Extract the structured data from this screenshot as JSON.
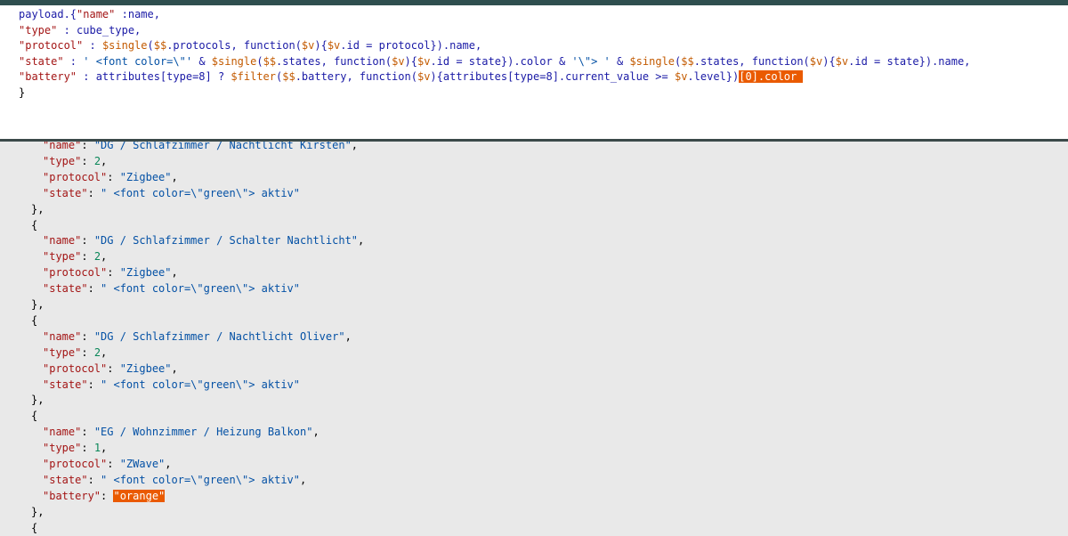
{
  "editor": {
    "lines": [
      {
        "segments": [
          {
            "t": "payload.{",
            "c": "plain"
          },
          {
            "t": "\"name\"",
            "c": "key"
          },
          {
            "t": " :name,",
            "c": "plain"
          }
        ]
      },
      {
        "segments": [
          {
            "t": "\"type\"",
            "c": "key"
          },
          {
            "t": " : cube_type,",
            "c": "plain"
          }
        ]
      },
      {
        "segments": [
          {
            "t": "\"protocol\"",
            "c": "key"
          },
          {
            "t": " : ",
            "c": "plain"
          },
          {
            "t": "$single",
            "c": "var"
          },
          {
            "t": "(",
            "c": "plain"
          },
          {
            "t": "$$",
            "c": "var"
          },
          {
            "t": ".protocols, function(",
            "c": "plain"
          },
          {
            "t": "$v",
            "c": "var"
          },
          {
            "t": "){",
            "c": "plain"
          },
          {
            "t": "$v",
            "c": "var"
          },
          {
            "t": ".id = protocol}).name,",
            "c": "plain"
          }
        ]
      },
      {
        "segments": [
          {
            "t": "\"state\"",
            "c": "key"
          },
          {
            "t": " : ",
            "c": "plain"
          },
          {
            "t": "' <font color=\\\"'",
            "c": "str"
          },
          {
            "t": " & ",
            "c": "plain"
          },
          {
            "t": "$single",
            "c": "var"
          },
          {
            "t": "(",
            "c": "plain"
          },
          {
            "t": "$$",
            "c": "var"
          },
          {
            "t": ".states, function(",
            "c": "plain"
          },
          {
            "t": "$v",
            "c": "var"
          },
          {
            "t": "){",
            "c": "plain"
          },
          {
            "t": "$v",
            "c": "var"
          },
          {
            "t": ".id = state}).color & ",
            "c": "plain"
          },
          {
            "t": "'\\\"> '",
            "c": "str"
          },
          {
            "t": " & ",
            "c": "plain"
          },
          {
            "t": "$single",
            "c": "var"
          },
          {
            "t": "(",
            "c": "plain"
          },
          {
            "t": "$$",
            "c": "var"
          },
          {
            "t": ".states, function(",
            "c": "plain"
          },
          {
            "t": "$v",
            "c": "var"
          },
          {
            "t": "){",
            "c": "plain"
          },
          {
            "t": "$v",
            "c": "var"
          },
          {
            "t": ".id = state}).name,",
            "c": "plain"
          }
        ]
      },
      {
        "segments": [
          {
            "t": "\"battery\"",
            "c": "key"
          },
          {
            "t": " : attributes[type=8] ? ",
            "c": "plain"
          },
          {
            "t": "$filter",
            "c": "var"
          },
          {
            "t": "(",
            "c": "plain"
          },
          {
            "t": "$$",
            "c": "var"
          },
          {
            "t": ".battery, function(",
            "c": "plain"
          },
          {
            "t": "$v",
            "c": "var"
          },
          {
            "t": "){attributes[type=8].current_value >= ",
            "c": "plain"
          },
          {
            "t": "$v",
            "c": "var"
          },
          {
            "t": ".level})",
            "c": "plain"
          },
          {
            "t": "[0].color ",
            "c": "hl"
          }
        ]
      },
      {
        "segments": [
          {
            "t": "}",
            "c": "op"
          }
        ]
      }
    ]
  },
  "output": {
    "lines": [
      {
        "indent": 1,
        "segments": [
          {
            "t": "\"name\"",
            "c": "key"
          },
          {
            "t": ": ",
            "c": "op"
          },
          {
            "t": "\"DG / Schlafzimmer / Nachtlicht Kirsten\"",
            "c": "str"
          },
          {
            "t": ",",
            "c": "op"
          }
        ]
      },
      {
        "indent": 1,
        "segments": [
          {
            "t": "\"type\"",
            "c": "key"
          },
          {
            "t": ": ",
            "c": "op"
          },
          {
            "t": "2",
            "c": "num"
          },
          {
            "t": ",",
            "c": "op"
          }
        ]
      },
      {
        "indent": 1,
        "segments": [
          {
            "t": "\"protocol\"",
            "c": "key"
          },
          {
            "t": ": ",
            "c": "op"
          },
          {
            "t": "\"Zigbee\"",
            "c": "str"
          },
          {
            "t": ",",
            "c": "op"
          }
        ]
      },
      {
        "indent": 1,
        "segments": [
          {
            "t": "\"state\"",
            "c": "key"
          },
          {
            "t": ": ",
            "c": "op"
          },
          {
            "t": "\" <font color=\\\"green\\\"> aktiv\"",
            "c": "str"
          }
        ]
      },
      {
        "indent": 0,
        "segments": [
          {
            "t": "},",
            "c": "op"
          }
        ]
      },
      {
        "indent": 0,
        "segments": [
          {
            "t": "{",
            "c": "op"
          }
        ]
      },
      {
        "indent": 1,
        "segments": [
          {
            "t": "\"name\"",
            "c": "key"
          },
          {
            "t": ": ",
            "c": "op"
          },
          {
            "t": "\"DG / Schlafzimmer / Schalter Nachtlicht\"",
            "c": "str"
          },
          {
            "t": ",",
            "c": "op"
          }
        ]
      },
      {
        "indent": 1,
        "segments": [
          {
            "t": "\"type\"",
            "c": "key"
          },
          {
            "t": ": ",
            "c": "op"
          },
          {
            "t": "2",
            "c": "num"
          },
          {
            "t": ",",
            "c": "op"
          }
        ]
      },
      {
        "indent": 1,
        "segments": [
          {
            "t": "\"protocol\"",
            "c": "key"
          },
          {
            "t": ": ",
            "c": "op"
          },
          {
            "t": "\"Zigbee\"",
            "c": "str"
          },
          {
            "t": ",",
            "c": "op"
          }
        ]
      },
      {
        "indent": 1,
        "segments": [
          {
            "t": "\"state\"",
            "c": "key"
          },
          {
            "t": ": ",
            "c": "op"
          },
          {
            "t": "\" <font color=\\\"green\\\"> aktiv\"",
            "c": "str"
          }
        ]
      },
      {
        "indent": 0,
        "segments": [
          {
            "t": "},",
            "c": "op"
          }
        ]
      },
      {
        "indent": 0,
        "segments": [
          {
            "t": "{",
            "c": "op"
          }
        ]
      },
      {
        "indent": 1,
        "segments": [
          {
            "t": "\"name\"",
            "c": "key"
          },
          {
            "t": ": ",
            "c": "op"
          },
          {
            "t": "\"DG / Schlafzimmer / Nachtlicht Oliver\"",
            "c": "str"
          },
          {
            "t": ",",
            "c": "op"
          }
        ]
      },
      {
        "indent": 1,
        "segments": [
          {
            "t": "\"type\"",
            "c": "key"
          },
          {
            "t": ": ",
            "c": "op"
          },
          {
            "t": "2",
            "c": "num"
          },
          {
            "t": ",",
            "c": "op"
          }
        ]
      },
      {
        "indent": 1,
        "segments": [
          {
            "t": "\"protocol\"",
            "c": "key"
          },
          {
            "t": ": ",
            "c": "op"
          },
          {
            "t": "\"Zigbee\"",
            "c": "str"
          },
          {
            "t": ",",
            "c": "op"
          }
        ]
      },
      {
        "indent": 1,
        "segments": [
          {
            "t": "\"state\"",
            "c": "key"
          },
          {
            "t": ": ",
            "c": "op"
          },
          {
            "t": "\" <font color=\\\"green\\\"> aktiv\"",
            "c": "str"
          }
        ]
      },
      {
        "indent": 0,
        "segments": [
          {
            "t": "},",
            "c": "op"
          }
        ]
      },
      {
        "indent": 0,
        "segments": [
          {
            "t": "{",
            "c": "op"
          }
        ]
      },
      {
        "indent": 1,
        "segments": [
          {
            "t": "\"name\"",
            "c": "key"
          },
          {
            "t": ": ",
            "c": "op"
          },
          {
            "t": "\"EG / Wohnzimmer / Heizung Balkon\"",
            "c": "str"
          },
          {
            "t": ",",
            "c": "op"
          }
        ]
      },
      {
        "indent": 1,
        "segments": [
          {
            "t": "\"type\"",
            "c": "key"
          },
          {
            "t": ": ",
            "c": "op"
          },
          {
            "t": "1",
            "c": "num"
          },
          {
            "t": ",",
            "c": "op"
          }
        ]
      },
      {
        "indent": 1,
        "segments": [
          {
            "t": "\"protocol\"",
            "c": "key"
          },
          {
            "t": ": ",
            "c": "op"
          },
          {
            "t": "\"ZWave\"",
            "c": "str"
          },
          {
            "t": ",",
            "c": "op"
          }
        ]
      },
      {
        "indent": 1,
        "segments": [
          {
            "t": "\"state\"",
            "c": "key"
          },
          {
            "t": ": ",
            "c": "op"
          },
          {
            "t": "\" <font color=\\\"green\\\"> aktiv\"",
            "c": "str"
          },
          {
            "t": ",",
            "c": "op"
          }
        ]
      },
      {
        "indent": 1,
        "segments": [
          {
            "t": "\"battery\"",
            "c": "key"
          },
          {
            "t": ": ",
            "c": "op"
          },
          {
            "t": "\"orange\"",
            "c": "hl"
          }
        ]
      },
      {
        "indent": 0,
        "segments": [
          {
            "t": "},",
            "c": "op"
          }
        ]
      },
      {
        "indent": 0,
        "segments": [
          {
            "t": "{",
            "c": "op"
          }
        ]
      }
    ]
  },
  "colors": {
    "highlight": "#ea5a00",
    "key": "#a31515",
    "string": "#0451a5",
    "number": "#098658",
    "variable": "#c35a00"
  }
}
